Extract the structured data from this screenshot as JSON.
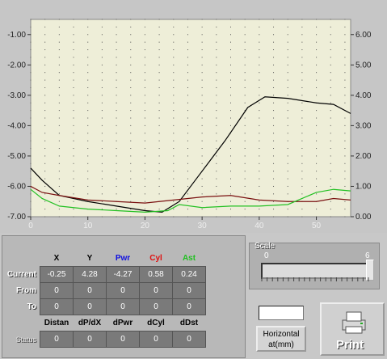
{
  "chart_data": {
    "type": "line",
    "x_ticks": [
      "0",
      "10",
      "20",
      "30",
      "40",
      "50"
    ],
    "y_left_ticks": [
      "-1.00",
      "-2.00",
      "-3.00",
      "-4.00",
      "-5.00",
      "-6.00",
      "-7.00"
    ],
    "y_right_ticks": [
      "6.00",
      "5.00",
      "4.00",
      "3.00",
      "2.00",
      "1.00",
      "0.00"
    ],
    "xlim": [
      0,
      56
    ],
    "ylim_left": [
      -7,
      -0.5
    ],
    "ylim_right": [
      0,
      6.5
    ],
    "grid": true,
    "series": [
      {
        "color": "#000000",
        "axis": "right",
        "points": [
          [
            0,
            1.6
          ],
          [
            2,
            1.2
          ],
          [
            5,
            0.7
          ],
          [
            10,
            0.5
          ],
          [
            15,
            0.35
          ],
          [
            20,
            0.2
          ],
          [
            23,
            0.15
          ],
          [
            26,
            0.5
          ],
          [
            30,
            1.5
          ],
          [
            34,
            2.5
          ],
          [
            38,
            3.6
          ],
          [
            41,
            3.95
          ],
          [
            45,
            3.9
          ],
          [
            50,
            3.75
          ],
          [
            53,
            3.7
          ],
          [
            56,
            3.4
          ]
        ]
      },
      {
        "color": "#7a1010",
        "axis": "right",
        "points": [
          [
            0,
            1.0
          ],
          [
            2,
            0.8
          ],
          [
            5,
            0.7
          ],
          [
            10,
            0.55
          ],
          [
            15,
            0.5
          ],
          [
            20,
            0.45
          ],
          [
            25,
            0.55
          ],
          [
            30,
            0.65
          ],
          [
            35,
            0.7
          ],
          [
            40,
            0.55
          ],
          [
            45,
            0.5
          ],
          [
            50,
            0.5
          ],
          [
            53,
            0.6
          ],
          [
            56,
            0.55
          ]
        ]
      },
      {
        "color": "#22c022",
        "axis": "right",
        "points": [
          [
            0,
            0.9
          ],
          [
            2,
            0.6
          ],
          [
            5,
            0.35
          ],
          [
            10,
            0.25
          ],
          [
            15,
            0.2
          ],
          [
            20,
            0.15
          ],
          [
            24,
            0.2
          ],
          [
            26,
            0.4
          ],
          [
            30,
            0.3
          ],
          [
            35,
            0.35
          ],
          [
            40,
            0.35
          ],
          [
            45,
            0.4
          ],
          [
            50,
            0.8
          ],
          [
            53,
            0.9
          ],
          [
            56,
            0.85
          ]
        ]
      }
    ]
  },
  "grid_table": {
    "columns": [
      {
        "label": "X",
        "color": "#000000"
      },
      {
        "label": "Y",
        "color": "#000000"
      },
      {
        "label": "Pwr",
        "color": "#1010e0"
      },
      {
        "label": "Cyl",
        "color": "#e01010"
      },
      {
        "label": "Ast",
        "color": "#20c020"
      }
    ],
    "rows": [
      {
        "label": "Current",
        "values": [
          "-0.25",
          "4.28",
          "-4.27",
          "0.58",
          "0.24"
        ]
      },
      {
        "label": "From",
        "values": [
          "0",
          "0",
          "0",
          "0",
          "0"
        ]
      },
      {
        "label": "To",
        "values": [
          "0",
          "0",
          "0",
          "0",
          "0"
        ]
      }
    ],
    "columns2": [
      "Distan",
      "dP/dX",
      "dPwr",
      "dCyl",
      "dDst"
    ],
    "row2": {
      "label": "Status",
      "values": [
        "0",
        "0",
        "0",
        "0",
        "0"
      ]
    }
  },
  "scale": {
    "title": "Scale",
    "min": "0",
    "max": "6",
    "value": 6
  },
  "horizontal_button": {
    "line1": "Horizontal",
    "line2": "at(mm)"
  },
  "print_button": {
    "label": "Print"
  },
  "colors": {
    "plot_bg": "#eeeed8",
    "grid_dot": "#555555"
  }
}
